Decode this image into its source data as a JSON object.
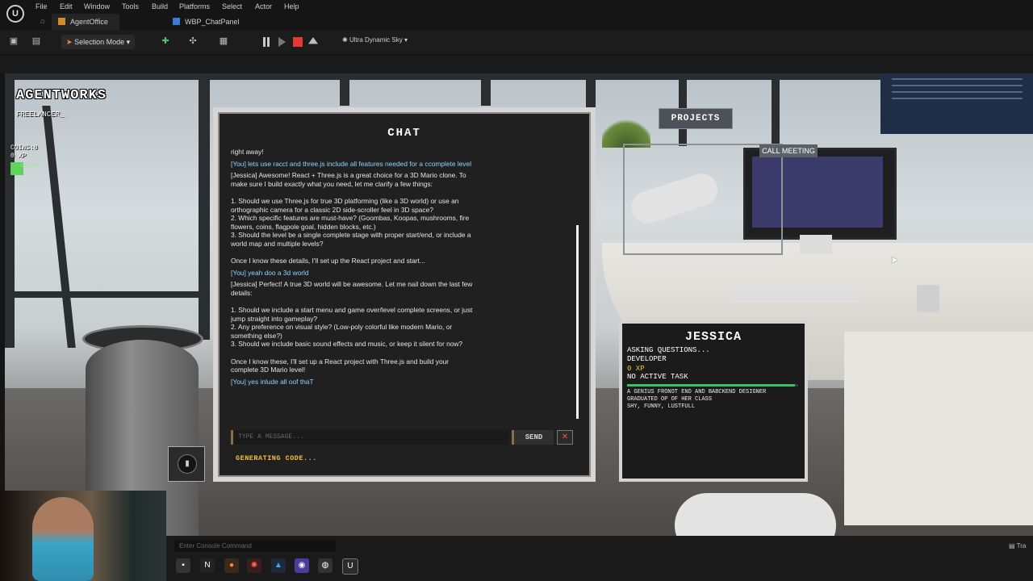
{
  "editor": {
    "menu": [
      "File",
      "Edit",
      "Window",
      "Tools",
      "Build",
      "Platforms",
      "Select",
      "Actor",
      "Help"
    ],
    "tabs": [
      "AgentOffice",
      "WBP_ChatPanel"
    ],
    "selection_mode": "Selection Mode",
    "sky_label": "Ultra Dynamic Sky",
    "console_placeholder": "Enter Console Command",
    "trace_label": "Tra"
  },
  "hud": {
    "title": "AGENTWORKS",
    "subtitle": "FREELANCER_",
    "coins": "COINS:0",
    "xp": "0 XP",
    "online": "ONLINE",
    "projects": "PROJECTS",
    "call_meeting": "CALL MEETING"
  },
  "chat": {
    "title": "CHAT",
    "messages": [
      {
        "role": "agent",
        "text": "right away!"
      },
      {
        "role": "you",
        "text": "[You] lets use racct and three.js include all features needed for a ccomplete level"
      },
      {
        "role": "agent",
        "text": "[Jessica] Awesome! React + Three.js is a great choice for a 3D Mario clone. To make sure I build exactly what you need, let me clarify a few things:\n\n1. Should we use Three.js for true 3D platforming (like a 3D world) or use an orthographic camera for a classic 2D side-scroller feel in 3D space?\n2. Which specific features are must-have? (Goombas, Koopas, mushrooms, fire flowers, coins, flagpole goal, hidden blocks, etc.)\n3. Should the level be a single complete stage with proper start/end, or include a world map and multiple levels?\n\nOnce I know these details, I'll set up the React project and start..."
      },
      {
        "role": "you",
        "text": "[You] yeah doo a 3d world"
      },
      {
        "role": "agent",
        "text": "[Jessica] Perfect! A true 3D world will be awesome. Let me nail down the last few details:\n\n1. Should we include a start menu and game over/level complete screens, or just jump straight into gameplay?\n2. Any preference on visual style? (Low-poly colorful like modern Mario, or something else?)\n3. Should we include basic sound effects and music, or keep it silent for now?\n\nOnce I know these, I'll set up a React project with Three.js and build your complete 3D Mario level!"
      },
      {
        "role": "you",
        "text": "[You] yes inlude all oof thaT"
      }
    ],
    "input_placeholder": "TYPE A MESSAGE...",
    "send_label": "SEND",
    "close_label": "✕",
    "status": "GENERATING CODE..."
  },
  "agent": {
    "name": "JESSICA",
    "status": "ASKING QUESTIONS...",
    "role": "DEVELOPER",
    "xp": "0 XP",
    "task": "NO ACTIVE TASK",
    "progress": 0.98,
    "bio": "A GENIUS FRONOT END AND BABCKEND DESIGNER",
    "bio2": "GRADUATED OP OF HER CLASS",
    "traits": "SHY, FUNNY, LUSTFULL"
  }
}
